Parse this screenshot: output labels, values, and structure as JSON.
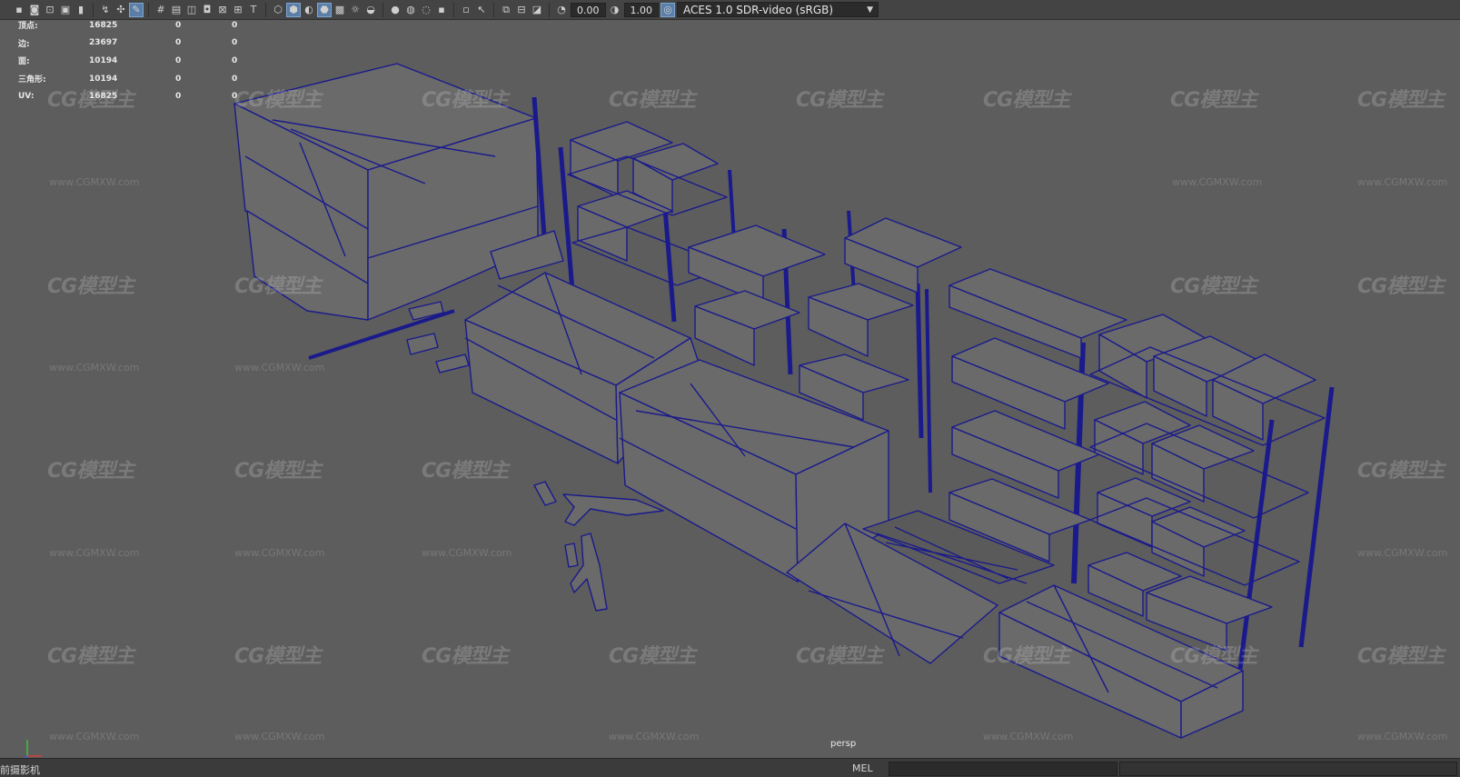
{
  "toolbar": {
    "icons": [
      "camera-icon",
      "camera-select-icon",
      "camera-move-icon",
      "camera-film-icon",
      "bookmark-icon",
      "curve-icon",
      "snap-icon",
      "paint-icon",
      "grid-icon",
      "film-gate-icon",
      "resolution-gate-icon",
      "gate-mask-icon",
      "field-chart-icon",
      "safe-action-icon",
      "safe-title-icon",
      "wireframe-icon",
      "smooth-shade-icon",
      "default-material-icon",
      "wireframe-on-shaded-icon",
      "xray-icon",
      "light-icon",
      "shadow-icon",
      "ambient-occlusion-icon",
      "motion-blur-icon",
      "anti-alias-icon",
      "depth-of-field-icon",
      "isolate-icon",
      "select-icon",
      "xray-joints-icon",
      "xray-active-icon",
      "exposure-icon",
      "gamma-icon",
      "color-manage-icon"
    ],
    "exposure_value": "0.00",
    "gamma_value": "1.00",
    "color_space": "ACES 1.0 SDR-video (sRGB)"
  },
  "hud": {
    "rows": [
      {
        "label": "顶点:",
        "v1": "16825",
        "v2": "0",
        "v3": "0"
      },
      {
        "label": "边:",
        "v1": "23697",
        "v2": "0",
        "v3": "0"
      },
      {
        "label": "面:",
        "v1": "10194",
        "v2": "0",
        "v3": "0"
      },
      {
        "label": "三角形:",
        "v1": "10194",
        "v2": "0",
        "v3": "0"
      },
      {
        "label": "UV:",
        "v1": "16825",
        "v2": "0",
        "v3": "0"
      }
    ]
  },
  "watermark": {
    "logo": "CG模型主",
    "url": "www.CGMXW.com"
  },
  "viewport": {
    "camera": "persp"
  },
  "bottom": {
    "status": "前摄影机",
    "mel": "MEL"
  },
  "colors": {
    "background": "#5d5d5d",
    "wireframe": "#1a1a8c",
    "toolbar": "#444444"
  }
}
